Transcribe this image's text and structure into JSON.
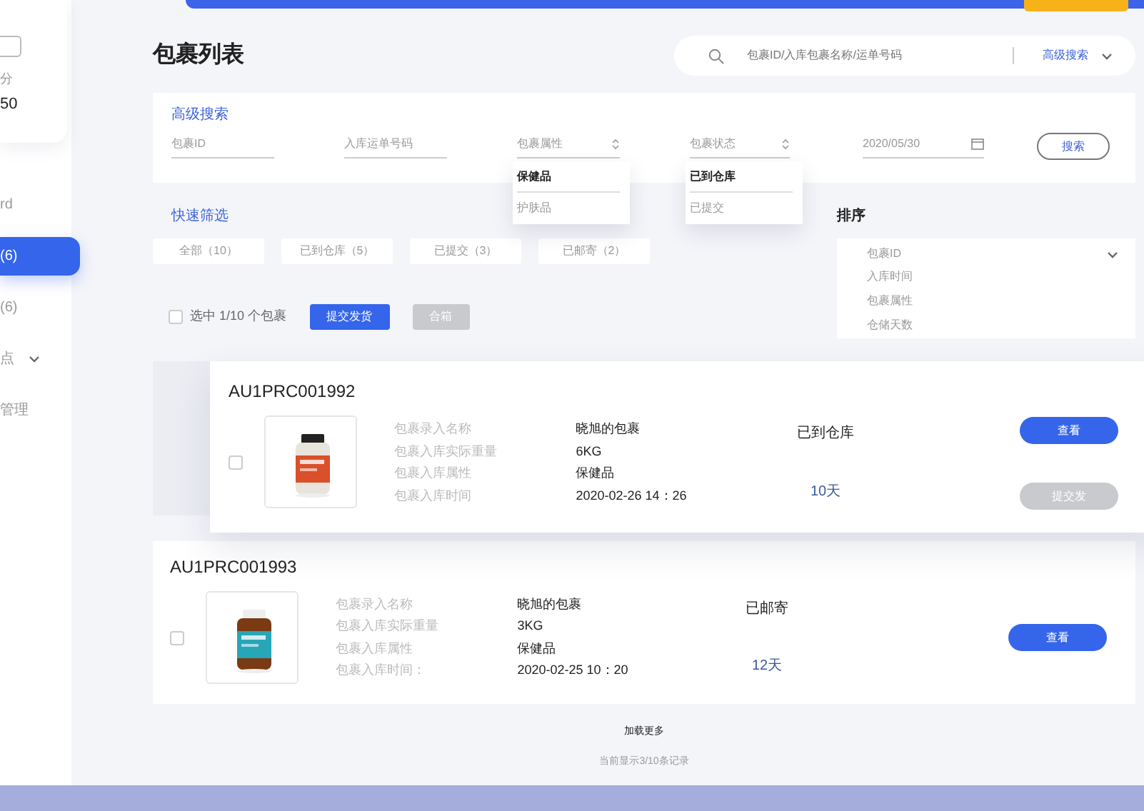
{
  "sidebar": {
    "points_label": "分",
    "points": "50",
    "items": [
      {
        "label": "rd",
        "selected": false,
        "expandable": false
      },
      {
        "label": "(6)",
        "selected": true,
        "expandable": false
      },
      {
        "label": "(6)",
        "selected": false,
        "expandable": false
      },
      {
        "label": "点",
        "selected": false,
        "expandable": true
      },
      {
        "label": "管理",
        "selected": false,
        "expandable": false
      }
    ]
  },
  "header": {
    "title": "包裹列表",
    "search": {
      "placeholder": "包裹ID/入库包裹名称/运单号码"
    },
    "advanced_toggle": "高级搜索"
  },
  "advanced_search": {
    "title": "高级搜索",
    "fields": [
      {
        "kind": "text",
        "placeholder": "包裹ID"
      },
      {
        "kind": "text",
        "placeholder": "入库运单号码"
      },
      {
        "kind": "select",
        "placeholder": "包裹属性",
        "options": [
          {
            "label": "保健品",
            "selected": true
          },
          {
            "label": "护肤品",
            "selected": false
          }
        ]
      },
      {
        "kind": "select",
        "placeholder": "包裹状态",
        "options": [
          {
            "label": "已到仓库",
            "selected": true
          },
          {
            "label": "已提交",
            "selected": false
          }
        ]
      },
      {
        "kind": "date",
        "value": "2020/05/30"
      }
    ],
    "button": "搜索"
  },
  "quick_filter": {
    "title": "快速筛选",
    "chips": [
      "全部（10）",
      "已到仓库（5）",
      "已提交（3）",
      "已邮寄（2）"
    ]
  },
  "sort": {
    "title": "排序",
    "value": "包裹ID",
    "options": [
      "入库时间",
      "包裹属性",
      "仓储天数"
    ]
  },
  "toolbar": {
    "checked": false,
    "selection": "选中 1/10 个包裹",
    "buttons": [
      {
        "label": "提交发货",
        "disabled": false
      },
      {
        "label": "合箱",
        "disabled": true
      }
    ]
  },
  "parcels": [
    {
      "id": "AU1PRC001992",
      "raised": true,
      "checked": false,
      "fields": [
        {
          "label": "包裹录入名称",
          "value": "晓旭的包裹"
        },
        {
          "label": "包裹入库实际重量",
          "value": "6KG"
        },
        {
          "label": "包裹入库属性",
          "value": "保健品"
        },
        {
          "label": "包裹入库时间",
          "value": "2020-02-26 14：26"
        }
      ],
      "status": "已到仓库",
      "days": "10天",
      "buttons": [
        {
          "label": "查看",
          "disabled": false
        },
        {
          "label": "提交发",
          "disabled": true
        }
      ]
    },
    {
      "id": "AU1PRC001993",
      "raised": false,
      "checked": false,
      "fields": [
        {
          "label": "包裹录入名称",
          "value": "晓旭的包裹"
        },
        {
          "label": "包裹入库实际重量",
          "value": "3KG"
        },
        {
          "label": "包裹入库属性",
          "value": "保健品"
        },
        {
          "label": "包裹入库时间：",
          "value": "2020-02-25 10：20"
        }
      ],
      "status": "已邮寄",
      "days": "12天",
      "buttons": [
        {
          "label": "查看",
          "disabled": false
        }
      ]
    }
  ],
  "footer": {
    "load_more": "加载更多",
    "count": "当前显示3/10条记录"
  }
}
